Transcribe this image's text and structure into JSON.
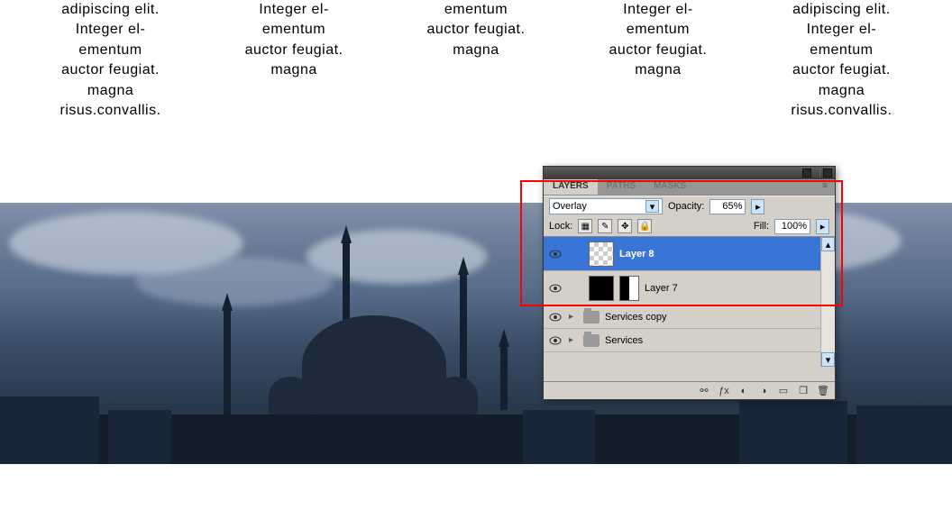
{
  "text_columns": [
    "adipiscing elit.\nInteger el-\nementum\nauctor feugiat.\nmagna\nrisus.convallis.",
    "Integer el-\nementum\nauctor feugiat.\nmagna",
    "ementum\nauctor feugiat.\nmagna",
    "Integer el-\nementum\nauctor feugiat.\nmagna",
    "adipiscing elit.\nInteger el-\nementum\nauctor feugiat.\nmagna\nrisus.convallis."
  ],
  "panel": {
    "tabs": [
      {
        "label": "LAYERS",
        "active": true
      },
      {
        "label": "PATHS",
        "active": false
      },
      {
        "label": "MASKS",
        "active": false
      }
    ],
    "blend_mode": "Overlay",
    "opacity_label": "Opacity:",
    "opacity_value": "65%",
    "lock_label": "Lock:",
    "fill_label": "Fill:",
    "fill_value": "100%",
    "layers": [
      {
        "name": "Layer 8",
        "selected": true,
        "type": "pixel"
      },
      {
        "name": "Layer 7",
        "selected": false,
        "type": "masked"
      },
      {
        "name": "Services copy",
        "selected": false,
        "type": "group"
      },
      {
        "name": "Services",
        "selected": false,
        "type": "group"
      }
    ]
  }
}
